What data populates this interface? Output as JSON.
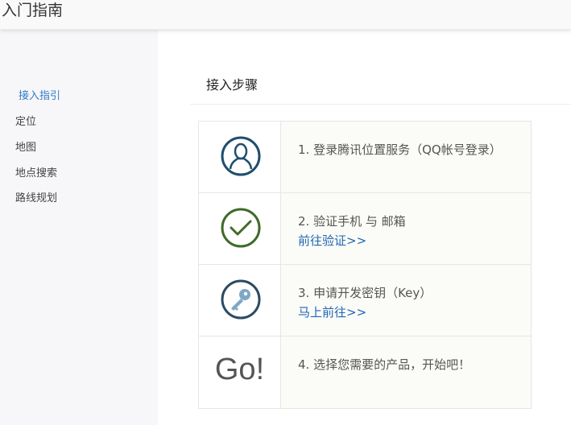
{
  "header": {
    "title": "入门指南"
  },
  "sidebar": {
    "items": [
      {
        "label": "接入指引"
      },
      {
        "label": "定位"
      },
      {
        "label": "地图"
      },
      {
        "label": "地点搜索"
      },
      {
        "label": "路线规划"
      }
    ],
    "active_index": 0
  },
  "main": {
    "section_title": "接入步骤",
    "steps": [
      {
        "icon": "user-icon",
        "text": "1. 登录腾讯位置服务（QQ帐号登录）",
        "link": ""
      },
      {
        "icon": "checkmark-icon",
        "text": "2. 验证手机 与 邮箱",
        "link": "前往验证>>"
      },
      {
        "icon": "key-icon",
        "text": "3. 申请开发密钥（Key）",
        "link": "马上前往>>"
      },
      {
        "icon": "go-icon",
        "icon_text": "Go!",
        "text": "4. 选择您需要的产品，开始吧！",
        "link": ""
      }
    ]
  },
  "colors": {
    "active_link": "#2f7bc8",
    "link": "#2067b5",
    "user_icon": "#1f4e6e",
    "check_icon": "#3f6b2a",
    "key_icon": "#2c4b63",
    "key_fill": "#7fa7c4"
  }
}
